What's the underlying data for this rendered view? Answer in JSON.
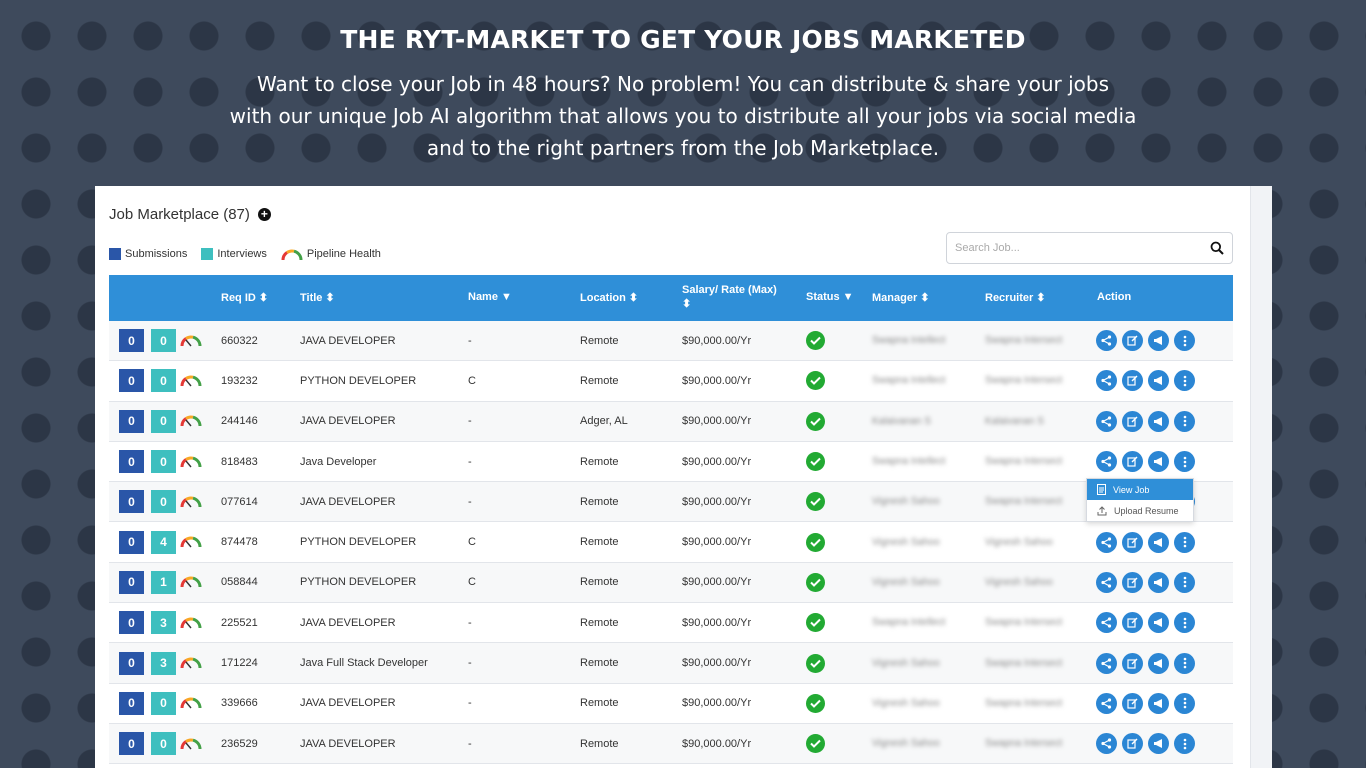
{
  "hero": {
    "title": "THE RYT-MARKET TO GET YOUR JOBS MARKETED",
    "line1": "Want to close your Job in 48 hours? No problem! You can distribute & share your jobs",
    "line2": "with our unique Job AI algorithm that allows you to distribute all your jobs via social media",
    "line3": "and to the right partners from the Job Marketplace."
  },
  "panel": {
    "title": "Job Marketplace (87)",
    "legend": {
      "submissions": "Submissions",
      "interviews": "Interviews",
      "pipeline": "Pipeline Health"
    },
    "search_placeholder": "Search Job..."
  },
  "colors": {
    "header": "#2f8fd8",
    "submissions": "#2a56a8",
    "interviews": "#3ebfbf",
    "status_ok": "#22aa33",
    "action": "#2b86d4"
  },
  "columns": {
    "req_id": "Req ID",
    "title": "Title",
    "name": "Name",
    "location": "Location",
    "salary_line1": "Salary/ Rate (Max)",
    "status": "Status",
    "manager": "Manager",
    "recruiter": "Recruiter",
    "action": "Action"
  },
  "rows": [
    {
      "sub": "0",
      "int": "0",
      "req": "660322",
      "title": "JAVA DEVELOPER",
      "name": "-",
      "loc": "Remote",
      "salary": "$90,000.00/Yr",
      "manager": "Swapna Intellect",
      "recruiter": "Swapna Intersect"
    },
    {
      "sub": "0",
      "int": "0",
      "req": "193232",
      "title": "PYTHON DEVELOPER",
      "name": "C",
      "loc": "Remote",
      "salary": "$90,000.00/Yr",
      "manager": "Swapna Intellect",
      "recruiter": "Swapna Intersect"
    },
    {
      "sub": "0",
      "int": "0",
      "req": "244146",
      "title": "JAVA DEVELOPER",
      "name": "-",
      "loc": "Adger, AL",
      "salary": "$90,000.00/Yr",
      "manager": "Kalaivanan S",
      "recruiter": "Kalaivanan S"
    },
    {
      "sub": "0",
      "int": "0",
      "req": "818483",
      "title": "Java Developer",
      "name": "-",
      "loc": "Remote",
      "salary": "$90,000.00/Yr",
      "manager": "Swapna Intellect",
      "recruiter": "Swapna Intersect"
    },
    {
      "sub": "0",
      "int": "0",
      "req": "077614",
      "title": "JAVA DEVELOPER",
      "name": "-",
      "loc": "Remote",
      "salary": "$90,000.00/Yr",
      "manager": "Vignesh Sahoo",
      "recruiter": "Swapna Intersect"
    },
    {
      "sub": "0",
      "int": "4",
      "req": "874478",
      "title": "PYTHON DEVELOPER",
      "name": "C",
      "loc": "Remote",
      "salary": "$90,000.00/Yr",
      "manager": "Vignesh Sahoo",
      "recruiter": "Vignesh Sahoo"
    },
    {
      "sub": "0",
      "int": "1",
      "req": "058844",
      "title": "PYTHON DEVELOPER",
      "name": "C",
      "loc": "Remote",
      "salary": "$90,000.00/Yr",
      "manager": "Vignesh Sahoo",
      "recruiter": "Vignesh Sahoo"
    },
    {
      "sub": "0",
      "int": "3",
      "req": "225521",
      "title": "JAVA DEVELOPER",
      "name": "-",
      "loc": "Remote",
      "salary": "$90,000.00/Yr",
      "manager": "Swapna Intellect",
      "recruiter": "Swapna Intersect"
    },
    {
      "sub": "0",
      "int": "3",
      "req": "171224",
      "title": "Java Full Stack Developer",
      "name": "-",
      "loc": "Remote",
      "salary": "$90,000.00/Yr",
      "manager": "Vignesh Sahoo",
      "recruiter": "Swapna Intersect"
    },
    {
      "sub": "0",
      "int": "0",
      "req": "339666",
      "title": "JAVA DEVELOPER",
      "name": "-",
      "loc": "Remote",
      "salary": "$90,000.00/Yr",
      "manager": "Vignesh Sahoo",
      "recruiter": "Swapna Intersect"
    },
    {
      "sub": "0",
      "int": "0",
      "req": "236529",
      "title": "JAVA DEVELOPER",
      "name": "-",
      "loc": "Remote",
      "salary": "$90,000.00/Yr",
      "manager": "Vignesh Sahoo",
      "recruiter": "Swapna Intersect"
    }
  ],
  "dropdown": {
    "view_job": "View Job",
    "upload_resume": "Upload Resume"
  }
}
